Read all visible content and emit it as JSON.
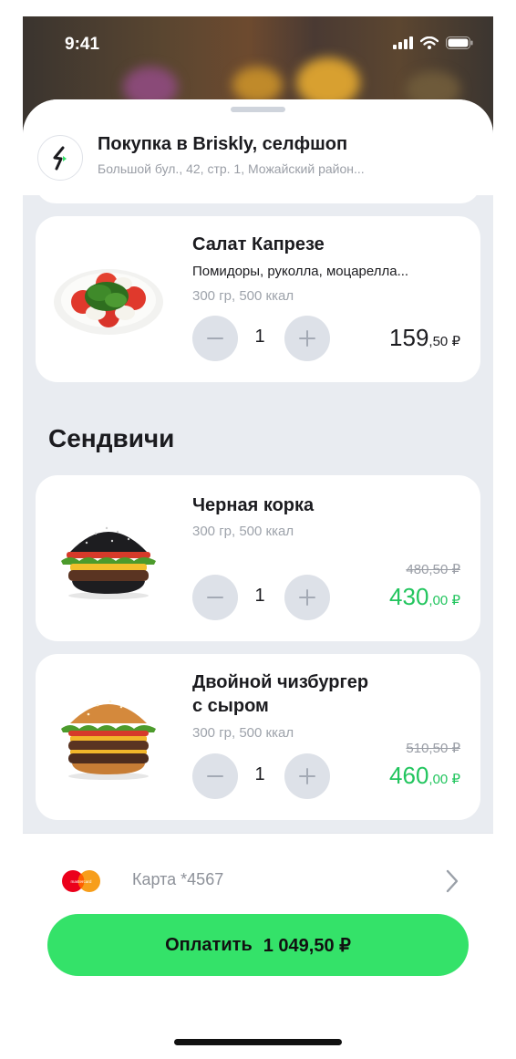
{
  "status": {
    "time": "9:41"
  },
  "store": {
    "title": "Покупка в Briskly, селфшоп",
    "address": "Большой бул., 42, стр. 1, Можайский район..."
  },
  "items": [
    {
      "name": "Салат Капрезе",
      "description": "Помидоры, руколла, моцарелла...",
      "meta": "300 гр, 500 ккал",
      "qty": "1",
      "price_int": "159",
      "price_frac": ",50 ₽"
    }
  ],
  "sections": [
    {
      "title": "Сендвичи",
      "items": [
        {
          "name": "Черная корка",
          "meta": "300 гр, 500 ккал",
          "qty": "1",
          "old_price": "480,50 ₽",
          "price_int": "430",
          "price_frac": ",00 ₽"
        },
        {
          "name_line1": "Двойной чизбургер",
          "name_line2": "с сыром",
          "meta": "300 гр, 500 ккал",
          "qty": "1",
          "old_price": "510,50 ₽",
          "price_int": "460",
          "price_frac": ",00 ₽"
        }
      ]
    }
  ],
  "payment": {
    "method_label": "Карта *4567",
    "brand_text": "mastercard",
    "pay_label": "Оплатить",
    "pay_amount": "1 049,50 ₽"
  },
  "colors": {
    "accent": "#34e269",
    "discount_price": "#22c55e",
    "sheet_bg": "#e9ecf1"
  },
  "icons": [
    "signal-icon",
    "wifi-icon",
    "battery-icon",
    "store-logo-icon",
    "minus-icon",
    "plus-icon",
    "mastercard-icon",
    "chevron-right-icon"
  ]
}
